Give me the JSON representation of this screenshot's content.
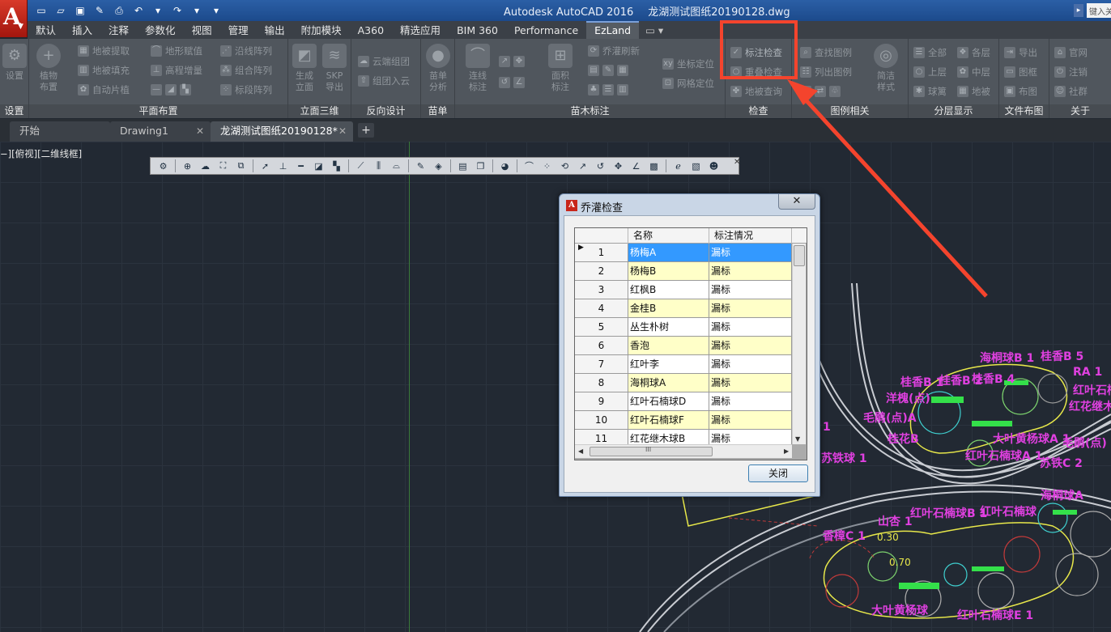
{
  "app": {
    "logo_letter": "A",
    "title": "Autodesk AutoCAD 2016",
    "file": "龙湖测试图纸20190128.dwg",
    "search_placeholder": "键入关键字"
  },
  "qat": [
    "new-icon",
    "open-icon",
    "save-icon",
    "saveas-icon",
    "print-icon",
    "undo-icon",
    "redo-icon",
    "dropdown-icon"
  ],
  "ribbon_tabs": [
    "默认",
    "插入",
    "注释",
    "参数化",
    "视图",
    "管理",
    "输出",
    "附加模块",
    "A360",
    "精选应用",
    "BIM 360",
    "Performance",
    "EzLand"
  ],
  "active_tab": "EzLand",
  "ribbon": {
    "panels": {
      "settings": "设置",
      "plane": "平面布置",
      "elevation": "立面三维",
      "reverse": "反向设计",
      "seedling": "苗单",
      "annotation": "苗木标注",
      "check": "检查",
      "legend": "图例相关",
      "layer": "分层显示",
      "filelayout": "文件布图",
      "about": "关于"
    },
    "buttons": {
      "settings": "设置",
      "plant_line1": "植物",
      "plant_line2": "布置",
      "extract_ground": "地被提取",
      "fill_ground": "地被填充",
      "auto_slice": "自动片植",
      "terrain": "地形赋值",
      "elevation_add": "高程增量",
      "along_array": "沿线阵列",
      "combo_array": "组合阵列",
      "mark_array": "标段阵列",
      "gen_elev_1": "生成",
      "gen_elev_2": "立面",
      "skp_1": "SKP",
      "skp_2": "导出",
      "cloud_group": "云端组团",
      "group_cloud": "组团入云",
      "seed_1": "苗单",
      "seed_2": "分析",
      "line_label_1": "连线",
      "line_label_2": "标注",
      "area_label_1": "面积",
      "area_label_2": "标注",
      "tree_refresh": "乔灌刷新",
      "coord_pos": "坐标定位",
      "grid_pos": "网格定位",
      "label_check": "标注检查",
      "overlap_check": "重叠检查",
      "ground_check": "地被查询",
      "find_legend": "查找图例",
      "list_legend": "列出图例",
      "simple_style_1": "简洁",
      "simple_style_2": "样式",
      "layer_all": "全部",
      "layer_top": "上层",
      "layer_ball": "球篱",
      "layer_each": "各层",
      "layer_mid": "中层",
      "layer_ground": "地被",
      "export": "导出",
      "frame": "图框",
      "layout": "布图",
      "website": "官网",
      "register": "注销",
      "community": "社群"
    }
  },
  "doc_tabs": [
    "开始",
    "Drawing1",
    "龙湖测试图纸20190128*"
  ],
  "view_label": "−][俯视][二维线框]",
  "drawing_labels": [
    "海桐球B 1",
    "桂香B 5",
    "桂香B 1",
    "桂香B 2",
    "桂香B 4",
    "RA 1",
    "红叶石楠球",
    "洋槐(点)",
    "红花继木球",
    "毛鹃(点)A",
    "桂花B",
    "大叶黄杨球A 1",
    "毛鹃(点)",
    "红叶石楠球A 1",
    "苏铁C 2",
    "苏铁球 1",
    "香樟C 1",
    "山杏 1",
    "红叶石楠球B 1",
    "红叶石楠球",
    "海桐球A",
    "红叶石楠球E 1",
    "大叶黄杨球",
    "0.30",
    "0.70",
    "1"
  ],
  "dialog": {
    "title": "乔灌检查",
    "close_x": "✕",
    "columns": [
      "名称",
      "标注情况"
    ],
    "rows": [
      {
        "num": "1",
        "name": "杨梅A",
        "status": "漏标"
      },
      {
        "num": "2",
        "name": "杨梅B",
        "status": "漏标"
      },
      {
        "num": "3",
        "name": "红枫B",
        "status": "漏标"
      },
      {
        "num": "4",
        "name": "金桂B",
        "status": "漏标"
      },
      {
        "num": "5",
        "name": "丛生朴树",
        "status": "漏标"
      },
      {
        "num": "6",
        "name": "香泡",
        "status": "漏标"
      },
      {
        "num": "7",
        "name": "红叶李",
        "status": "漏标"
      },
      {
        "num": "8",
        "name": "海桐球A",
        "status": "漏标"
      },
      {
        "num": "9",
        "name": "红叶石楠球D",
        "status": "漏标"
      },
      {
        "num": "10",
        "name": "红叶石楠球F",
        "status": "漏标"
      },
      {
        "num": "11",
        "name": "红花继木球B",
        "status": "漏标"
      }
    ],
    "selected_row": "1",
    "close_button": "关闭",
    "hscroll_grip": "III"
  },
  "colors": {
    "highlight": "#f4442d",
    "selection": "#3399ff",
    "alt_row": "#ffffc8",
    "annotation_text": "#e040e0"
  }
}
